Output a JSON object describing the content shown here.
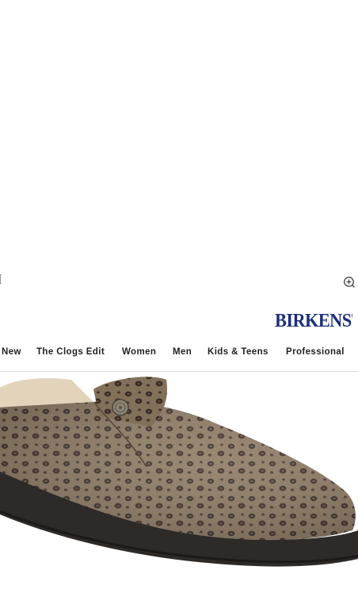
{
  "brand": {
    "logo_text": "BIRKENSTO",
    "color": "#1b2e7a"
  },
  "header": {
    "zoom_icon": "zoom-in-icon"
  },
  "nav": {
    "items": [
      {
        "label": "New"
      },
      {
        "label": "The Clogs Edit"
      },
      {
        "label": "Women"
      },
      {
        "label": "Men"
      },
      {
        "label": "Kids & Teens"
      },
      {
        "label": "Professional"
      }
    ]
  },
  "hero": {
    "image": "leopard-print-felt-clog",
    "colors": {
      "felt": "#8e7a63",
      "spots": "#3a2f28",
      "sole": "#2d2a28",
      "shearling": "#e2d3bb"
    }
  }
}
